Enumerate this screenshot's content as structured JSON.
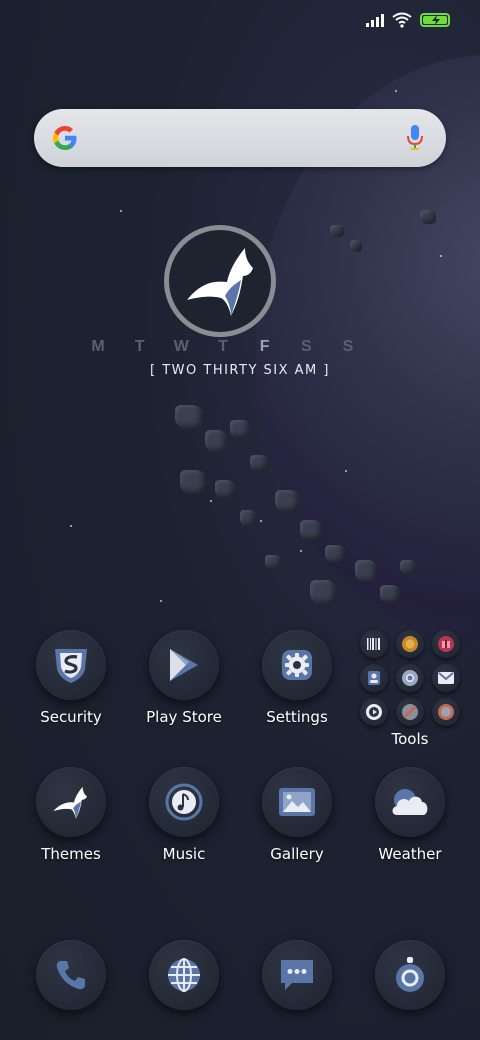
{
  "status_bar": {
    "signal_icon": "signal-icon",
    "wifi_icon": "wifi-icon",
    "battery_icon": "battery-charging-icon",
    "accent": "#6fdc3a"
  },
  "search_widget": {
    "logo_icon": "google-g-icon",
    "mic_icon": "mic-icon"
  },
  "clock_widget": {
    "logo_icon": "wolf-icon",
    "days": [
      "M",
      "T",
      "W",
      "T",
      "F",
      "S",
      "S"
    ],
    "today": "F",
    "time_text": "[ TWO THIRTY SIX AM ]"
  },
  "apps_row1": [
    {
      "label": "Security",
      "icon": "shield-icon"
    },
    {
      "label": "Play Store",
      "icon": "play-store-icon"
    },
    {
      "label": "Settings",
      "icon": "gear-icon"
    }
  ],
  "tools_folder": {
    "label": "Tools",
    "items": [
      "barcode-icon",
      "coin-icon",
      "gift-icon",
      "contacts-icon",
      "chrome-icon",
      "gmail-icon",
      "play-icon",
      "app-icon",
      "app-icon"
    ]
  },
  "apps_row2": [
    {
      "label": "Themes",
      "icon": "wolf-icon"
    },
    {
      "label": "Music",
      "icon": "music-icon"
    },
    {
      "label": "Gallery",
      "icon": "gallery-icon"
    },
    {
      "label": "Weather",
      "icon": "cloud-icon"
    }
  ],
  "dock": [
    {
      "icon": "phone-icon"
    },
    {
      "icon": "globe-icon"
    },
    {
      "icon": "message-icon"
    },
    {
      "icon": "camera-icon"
    }
  ],
  "colors": {
    "icon_blue": "#5a76a8",
    "background": "#1d2231"
  }
}
